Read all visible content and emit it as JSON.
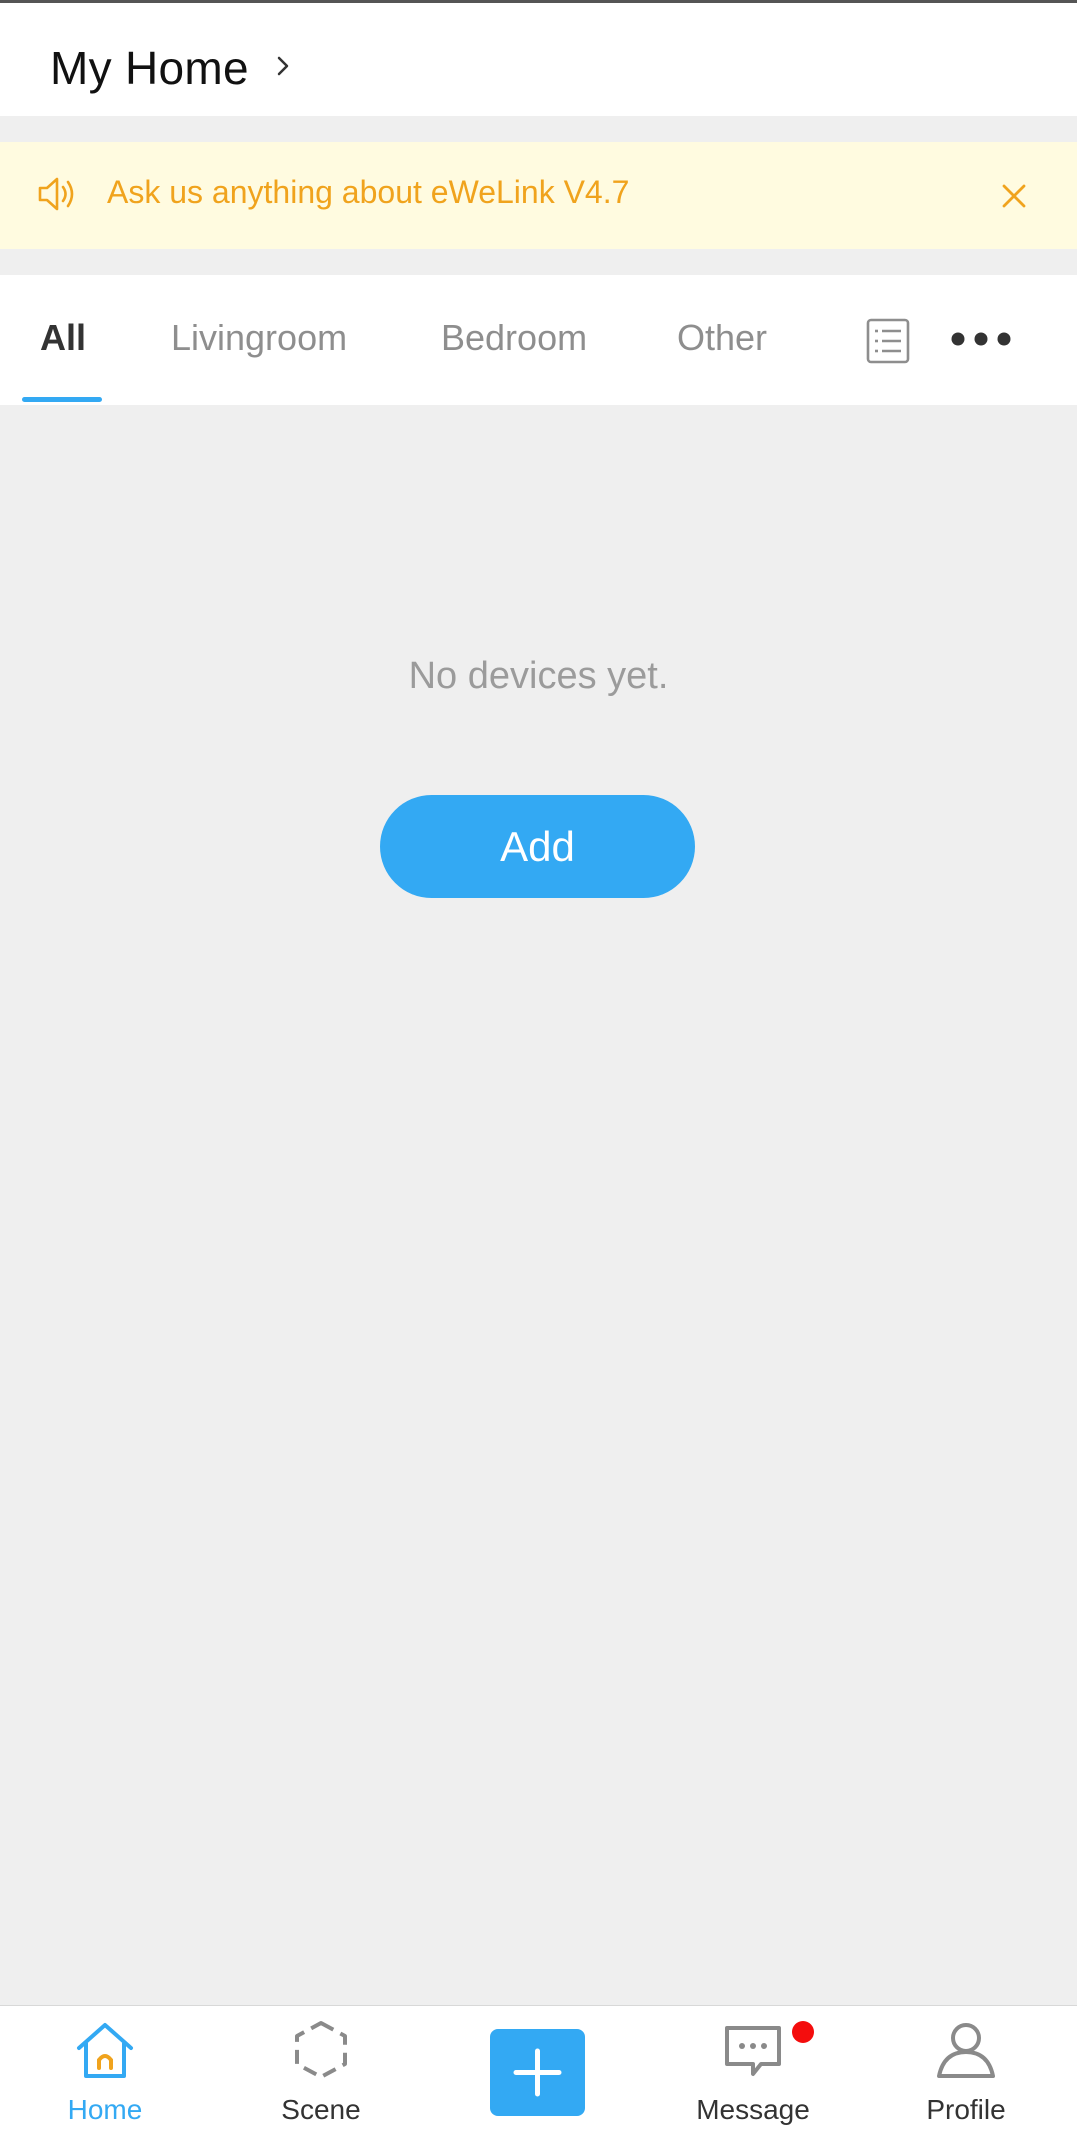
{
  "header": {
    "title": "My Home"
  },
  "banner": {
    "text": "Ask us anything about eWeLink V4.7"
  },
  "tabs": [
    {
      "label": "All",
      "active": true
    },
    {
      "label": "Livingroom",
      "active": false
    },
    {
      "label": "Bedroom",
      "active": false
    },
    {
      "label": "Other",
      "active": false
    }
  ],
  "empty_state": {
    "message": "No devices yet.",
    "add_label": "Add"
  },
  "bottom_nav": [
    {
      "label": "Home",
      "icon": "home-icon",
      "active": true
    },
    {
      "label": "Scene",
      "icon": "scene-icon",
      "active": false
    },
    {
      "label": "",
      "icon": "plus-icon",
      "active": false
    },
    {
      "label": "Message",
      "icon": "message-icon",
      "active": false,
      "badge": true
    },
    {
      "label": "Profile",
      "icon": "profile-icon",
      "active": false
    }
  ],
  "colors": {
    "accent": "#33a9f3",
    "banner_text": "#f0a31d",
    "banner_bg": "#fffbe0",
    "badge": "#f40d0d"
  }
}
